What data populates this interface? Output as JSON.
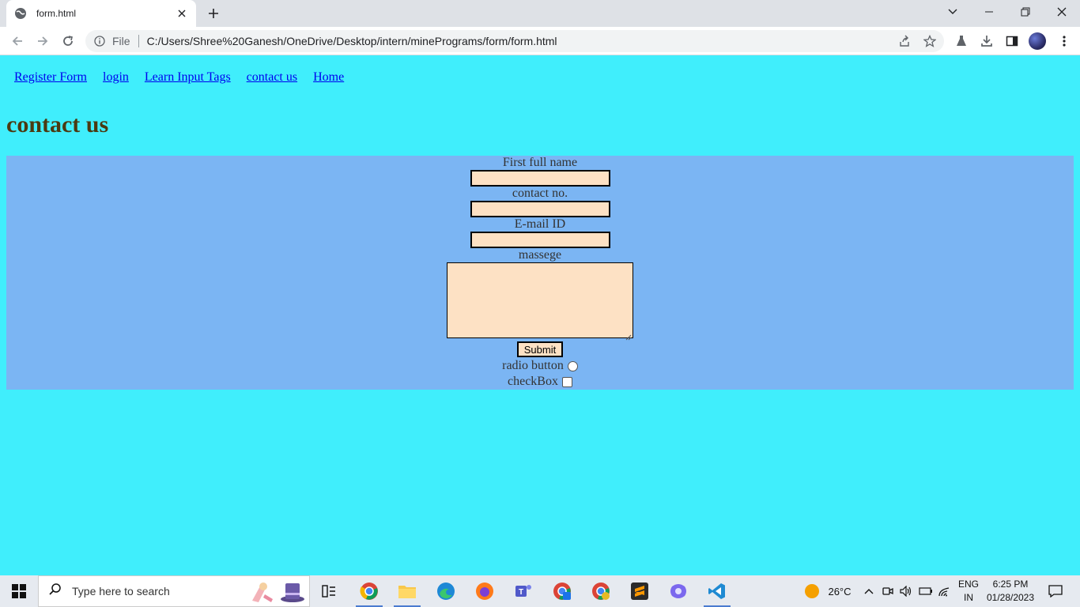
{
  "browser": {
    "tab_title": "form.html",
    "scheme": "File",
    "url": "C:/Users/Shree%20Ganesh/OneDrive/Desktop/intern/minePrograms/form/form.html"
  },
  "page": {
    "nav_links": [
      "Register Form",
      "login",
      "Learn Input Tags",
      "contact us",
      "Home"
    ],
    "heading": "contact us",
    "form": {
      "first_name_label": "First full name",
      "contact_label": "contact no.",
      "email_label": "E-mail ID",
      "message_label": "massege",
      "submit_label": "Submit",
      "radio_label": "radio button",
      "checkbox_label": "checkBox"
    }
  },
  "taskbar": {
    "search_placeholder": "Type here to search",
    "weather": "26°C",
    "lang_line1": "ENG",
    "lang_line2": "IN",
    "time": "6:25 PM",
    "date": "01/28/2023"
  },
  "colors": {
    "page_bg": "#40eefc",
    "form_bg": "#7bb5f3",
    "input_bg": "#fde1c4",
    "heading": "#4b3a12"
  }
}
